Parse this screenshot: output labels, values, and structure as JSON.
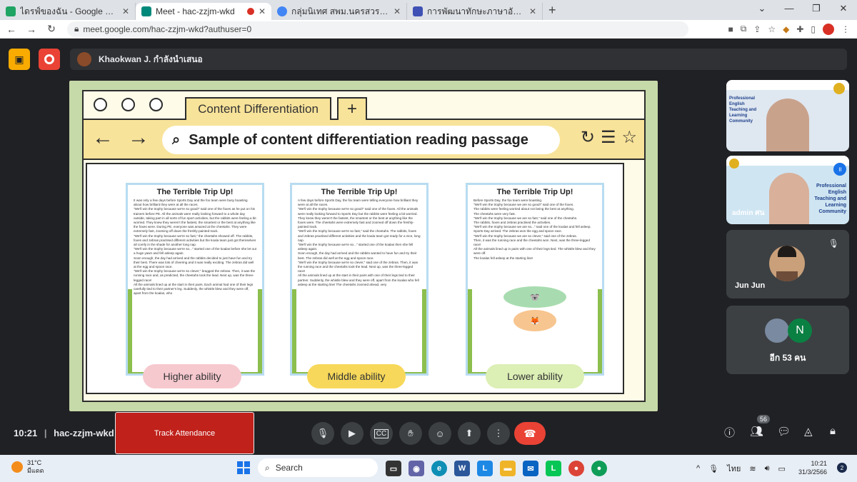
{
  "browser": {
    "tabs": [
      {
        "title": "ไดรฟ์ของฉัน - Google ไดรฟ์",
        "favicon_color": "#1fa463"
      },
      {
        "title": "Meet - hac-zzjm-wkd",
        "favicon_color": "#00897b",
        "active": true
      },
      {
        "title": "กลุ่มนิเทศ สพม.นครสวรรค์",
        "favicon_color": "#4285f4"
      },
      {
        "title": "การพัฒนาทักษะภาษาอังกฤษ English",
        "favicon_color": "#3f51b5"
      }
    ],
    "url": "meet.google.com/hac-zzjm-wkd?authuser=0"
  },
  "meet": {
    "presenter_text": "Khaokwan J. กำลังนำเสนอ",
    "slide": {
      "tab_label": "Content Differentiation",
      "search_text": "Sample of content differentiation reading passage",
      "passages": [
        {
          "title": "The Terrible Trip Up!",
          "text": "It was only a few days before Sports Day and the fox team were busy boasting about how brilliant they were at all the races.\n\"We'll win the trophy because we're so good!\" said one of the foxes as he put on his trainers before PE. All the animals were really looking forward to a whole day outside, taking part in all sorts of fun sport activities, but the rabbits were feeling a bit worried. They knew they weren't the fastest, the smartest or the best at anything like the foxes were. During PE, everyone was amazed at the cheetahs. They were extremely fast, zooming off down the freshly-painted track.\n\"We'll win the trophy because we're so fast,\" the cheetahs showed off. The rabbits, foxes and zebras practised different activities but the koala team just got themselves all comfy in the shade for another long nap.\n\"We'll win the trophy because we're so...\" started one of the koalas before she let out a huge yawn and fell asleep again.\nSoon enough, the day had arrived and the rabbits decided to just have fun and try their best. There was lots of cheering and it was really exciting. The zebras did well at the egg and spoon race.\n\"We'll win the trophy because we're so clever,\" bragged the zebras. Then, it was the running race and, as predicted, the cheetahs took the lead. Next up, was the three-legged race!\nAll the animals lined up at the start in their pairs. Each animal had one of their legs carefully tied to their partner's leg. Suddenly, the whistle blew and they were off, apart from the koalas, who",
          "badge": "Higher ability",
          "badge_color": "#f6c9cf"
        },
        {
          "title": "The Terrible Trip Up!",
          "text": "A few days before Sports Day, the fox team were telling everyone how brilliant they were at all the races.\n\"We'll win the trophy because we're so good!\" said one of the foxes. All the animals were really looking forward to Sports Day but the rabbits were feeling a bit worried. They knew they weren't the fastest, the smartest or the best at anything like the foxes were. The cheetahs were extremely fast and zoomed off down the freshly-painted track.\n\"We'll win the trophy because we're so fast,\" said the cheetahs. The rabbits, foxes and zebras practised different activities and the koala team got ready for a nice, long nap.\n\"We'll win the trophy because we're so...\" started one of the koalas then she fell asleep again.\nSoon enough, the day had arrived and the rabbits wanted to have fun and try their best. The zebras did well at the egg and spoon race.\n\"We'll win the trophy because we're so clever,\" said one of the zebras. Then, it was the running race and the cheetahs took the lead. Next up, was the three-legged race!\nAll the animals lined up at the start in their pairs with one of their legs tied to their partner. Suddenly, the whistle blew and they were off, apart from the koalas who fell asleep at the starting line! The cheetahs zoomed ahead, very",
          "badge": "Middle ability",
          "badge_color": "#f7d85a"
        },
        {
          "title": "The Terrible Trip Up!",
          "text": "Before Sports Day, the fox team were boasting.\n\"We'll win the trophy because we are so good!\" said one of the foxes.\nThe rabbits were feeling worried about not being the best at anything.\nThe cheetahs were very fast.\n\"We'll win the trophy because we are so fast,\" said one of the cheetahs.\nThe rabbits, foxes and zebras practised the activities.\n\"We'll win the trophy because we are so...\" said one of the koalas and fell asleep.\nSports Day arrived. The zebras won the egg and spoon race.\n\"We'll win the trophy because we are so clever,\" said one of the zebras.\nThen, it was the running race and the cheetahs won. Next, was the three-legged race!\nAll the animals lined up in pairs with one of their legs tied. The whistle blew and they were off.\nThe koalas fell asleep at the starting line!",
          "badge": "Lower ability",
          "badge_color": "#dcefb5"
        }
      ]
    },
    "participants": [
      {
        "name": "Jun Jun"
      },
      {
        "name": "อีก 53 คน",
        "initial": "N"
      }
    ],
    "tile_texts": {
      "tile1": "Professional English Teaching and Learning Community",
      "tile2_name": "admin ศน"
    },
    "bottom": {
      "time": "10:21",
      "meeting_code": "hac-zzjm-wkd",
      "track_attendance": "Track Attendance",
      "people_count": "56"
    }
  },
  "taskbar": {
    "weather_temp": "31°C",
    "weather_desc": "มีแดด",
    "search": "Search",
    "lang": "ไทย",
    "time": "10:21",
    "date": "31/3/2566",
    "notif": "2"
  }
}
